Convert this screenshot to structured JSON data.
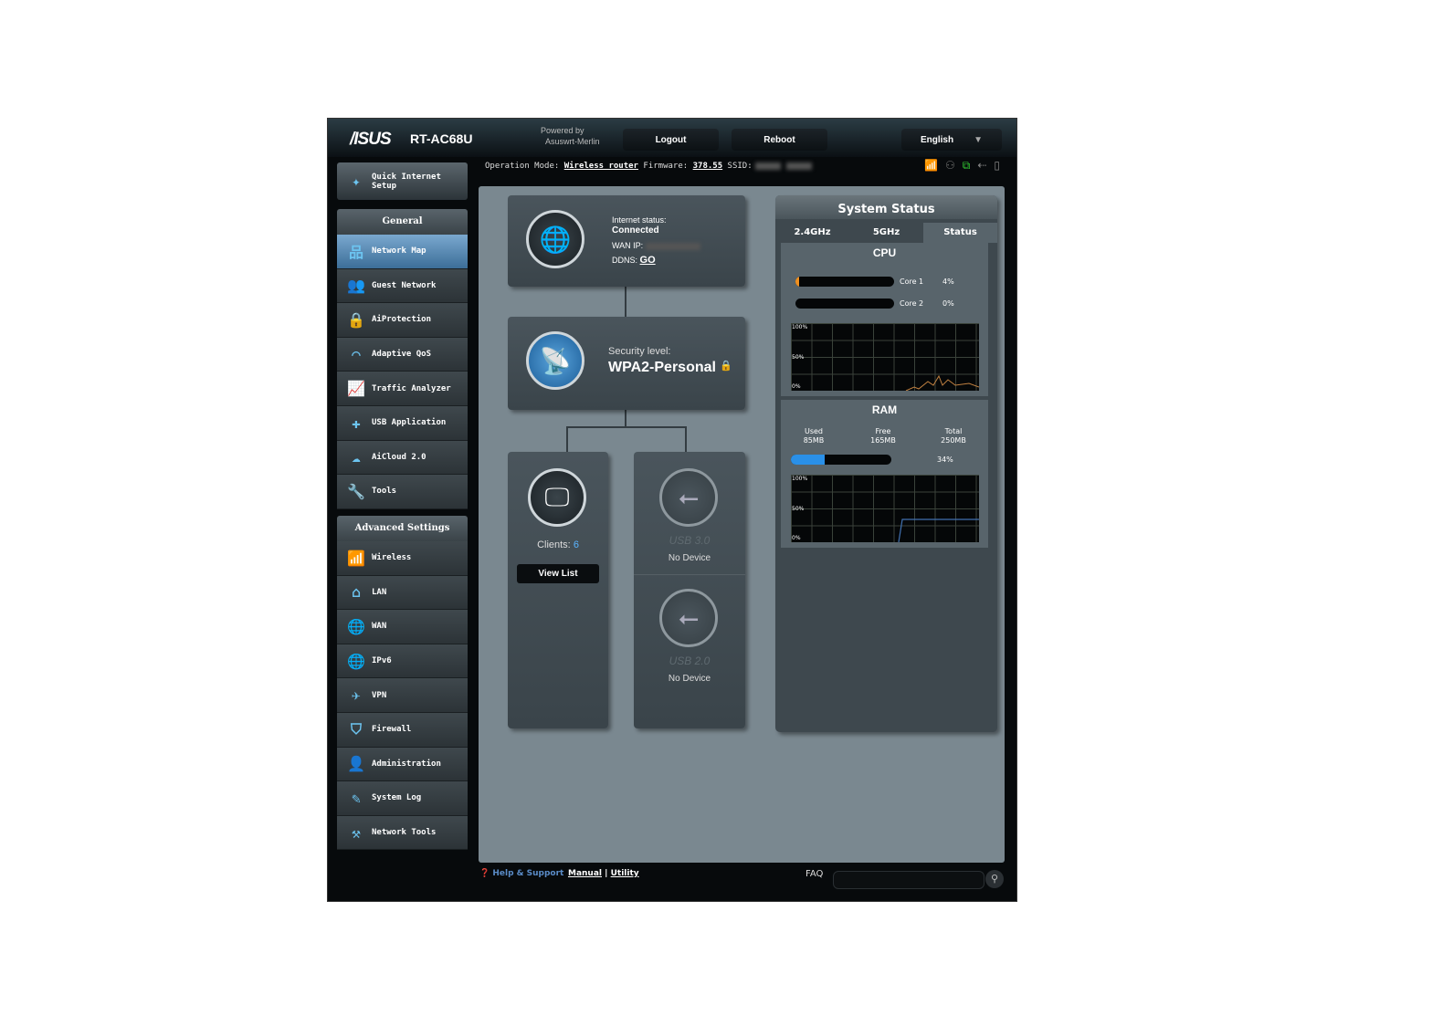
{
  "header": {
    "brand": "/ISUS",
    "model": "RT-AC68U",
    "powered_by": "Powered by",
    "firmware_name": "Asuswrt-Merlin",
    "logout": "Logout",
    "reboot": "Reboot",
    "language": "English"
  },
  "opbar": {
    "mode_label": "Operation Mode:",
    "mode": "Wireless router",
    "fw_label": "Firmware:",
    "fw": "378.55",
    "ssid_label": "SSID:"
  },
  "sidebar": {
    "quick_setup": "Quick Internet Setup",
    "general": "General",
    "general_items": [
      {
        "label": "Network Map",
        "icon": "network-map"
      },
      {
        "label": "Guest Network",
        "icon": "guest"
      },
      {
        "label": "AiProtection",
        "icon": "lock"
      },
      {
        "label": "Adaptive QoS",
        "icon": "gauge"
      },
      {
        "label": "Traffic Analyzer",
        "icon": "chart"
      },
      {
        "label": "USB Application",
        "icon": "puzzle"
      },
      {
        "label": "AiCloud 2.0",
        "icon": "cloud"
      },
      {
        "label": "Tools",
        "icon": "wrench"
      }
    ],
    "advanced": "Advanced Settings",
    "advanced_items": [
      {
        "label": "Wireless",
        "icon": "wifi"
      },
      {
        "label": "LAN",
        "icon": "home"
      },
      {
        "label": "WAN",
        "icon": "globe"
      },
      {
        "label": "IPv6",
        "icon": "globe"
      },
      {
        "label": "VPN",
        "icon": "vpn"
      },
      {
        "label": "Firewall",
        "icon": "shield"
      },
      {
        "label": "Administration",
        "icon": "user"
      },
      {
        "label": "System Log",
        "icon": "log"
      },
      {
        "label": "Network Tools",
        "icon": "tools"
      }
    ]
  },
  "map": {
    "internet_label": "Internet status:",
    "internet_status": "Connected",
    "wan_ip_label": "WAN IP:",
    "ddns_label": "DDNS:",
    "ddns_value": "GO",
    "security_label": "Security level:",
    "security_value": "WPA2-Personal",
    "clients_label": "Clients:",
    "clients_count": "6",
    "view_list": "View List",
    "usb3": "USB 3.0",
    "usb3_status": "No Device",
    "usb2": "USB 2.0",
    "usb2_status": "No Device"
  },
  "status": {
    "title": "System Status",
    "tabs": [
      "2.4GHz",
      "5GHz",
      "Status"
    ],
    "cpu_title": "CPU",
    "cores": [
      {
        "name": "Core 1",
        "pct": "4%",
        "value": 4
      },
      {
        "name": "Core 2",
        "pct": "0%",
        "value": 0
      }
    ],
    "axis": [
      "100%",
      "50%",
      "0%"
    ],
    "ram_title": "RAM",
    "used_label": "Used",
    "used": "85MB",
    "free_label": "Free",
    "free": "165MB",
    "total_label": "Total",
    "total": "250MB",
    "ram_pct": "34%",
    "ram_value": 34
  },
  "footer": {
    "help": "Help & Support",
    "manual": "Manual",
    "sep": "|",
    "utility": "Utility",
    "faq": "FAQ"
  }
}
